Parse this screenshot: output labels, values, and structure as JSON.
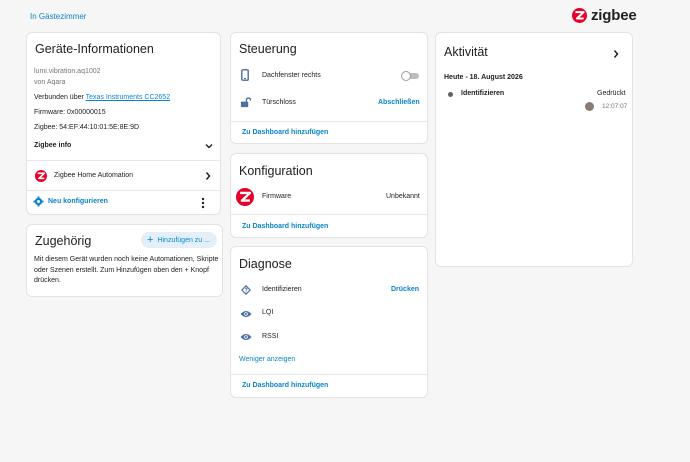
{
  "breadcrumb": "In Gästezimmer",
  "brand": {
    "name": "zigbee",
    "color": "#e4002b",
    "icon": "zigbee-logo-icon"
  },
  "colors": {
    "link": "#0a84c9",
    "text": "#212121",
    "muted": "#757575"
  },
  "device_info": {
    "title": "Geräte-Informationen",
    "model": "lumi.vibration.aq1002",
    "manufacturer": "von Aqara",
    "connected_prefix": "Verbunden über",
    "connected_link": "Texas Instruments CC2652",
    "firmware": "Firmware: 0x00000015",
    "zigbee_id": "Zigbee: 54:EF:44:10:01:5E:8E:9D",
    "zigbee_info_label": "Zigbee info",
    "integration_label": "Zigbee Home Automation",
    "reconfigure_label": "Neu konfigurieren"
  },
  "related": {
    "title": "Zugehörig",
    "add_button": "Hinzufügen zu ...",
    "description": "Mit diesem Gerät wurden noch keine Automationen, Skripte oder Szenen erstellt. Zum Hinzufügen oben den + Knopf drücken."
  },
  "controls": {
    "title": "Steuerung",
    "items": [
      {
        "icon": "phone-icon",
        "label": "Dachfenster rechts",
        "state": "off"
      },
      {
        "icon": "lock-open-icon",
        "label": "Türschloss",
        "action": "Abschließen"
      }
    ],
    "add_dashboard": "Zu Dashboard hinzufügen"
  },
  "configuration": {
    "title": "Konfiguration",
    "items": [
      {
        "icon": "zigbee-logo-icon",
        "label": "Firmware",
        "value": "Unbekannt"
      }
    ],
    "add_dashboard": "Zu Dashboard hinzufügen"
  },
  "diagnostics": {
    "title": "Diagnose",
    "items": [
      {
        "icon": "identify-icon",
        "label": "Identifizieren",
        "action": "Drücken"
      },
      {
        "icon": "eye-icon",
        "label": "LQI"
      },
      {
        "icon": "eye-icon",
        "label": "RSSI"
      }
    ],
    "show_less": "Weniger anzeigen",
    "add_dashboard": "Zu Dashboard hinzufügen"
  },
  "activity": {
    "title": "Aktivität",
    "date_header": "Heute - 18. August 2026",
    "entries": [
      {
        "label": "Identifizieren",
        "state": "Gedrückt",
        "time": "12:07:07"
      }
    ]
  }
}
